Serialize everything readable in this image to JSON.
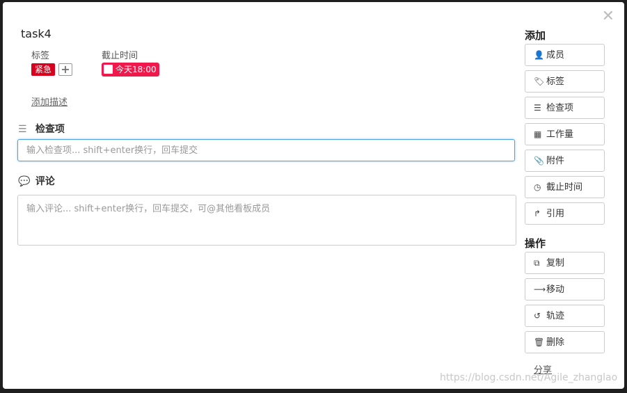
{
  "dialog": {
    "title": "task4",
    "close_symbol": "✕"
  },
  "meta": {
    "tags_label": "标签",
    "due_label": "截止时间",
    "tag": "紧急",
    "tag_add_symbol": "+",
    "due_value": "今天18:00"
  },
  "description": {
    "link": "添加描述"
  },
  "checklist": {
    "heading": "检查项",
    "placeholder": "输入检查项... shift+enter换行，回车提交"
  },
  "comment": {
    "heading": "评论",
    "placeholder": "输入评论... shift+enter换行，回车提交，可@其他看板成员"
  },
  "sidebar": {
    "add_heading": "添加",
    "add_buttons": [
      "成员",
      "标签",
      "检查项",
      "工作量",
      "附件",
      "截止时间",
      "引用"
    ],
    "ops_heading": "操作",
    "ops_buttons": [
      "复制",
      "移动",
      "轨迹",
      "删除"
    ],
    "share_link": "分享"
  },
  "watermark": "https://blog.csdn.net/Agile_zhanglao",
  "colors": {
    "urgent": "#d8001c",
    "due": "#f0194c",
    "focus": "#4aa3df"
  }
}
